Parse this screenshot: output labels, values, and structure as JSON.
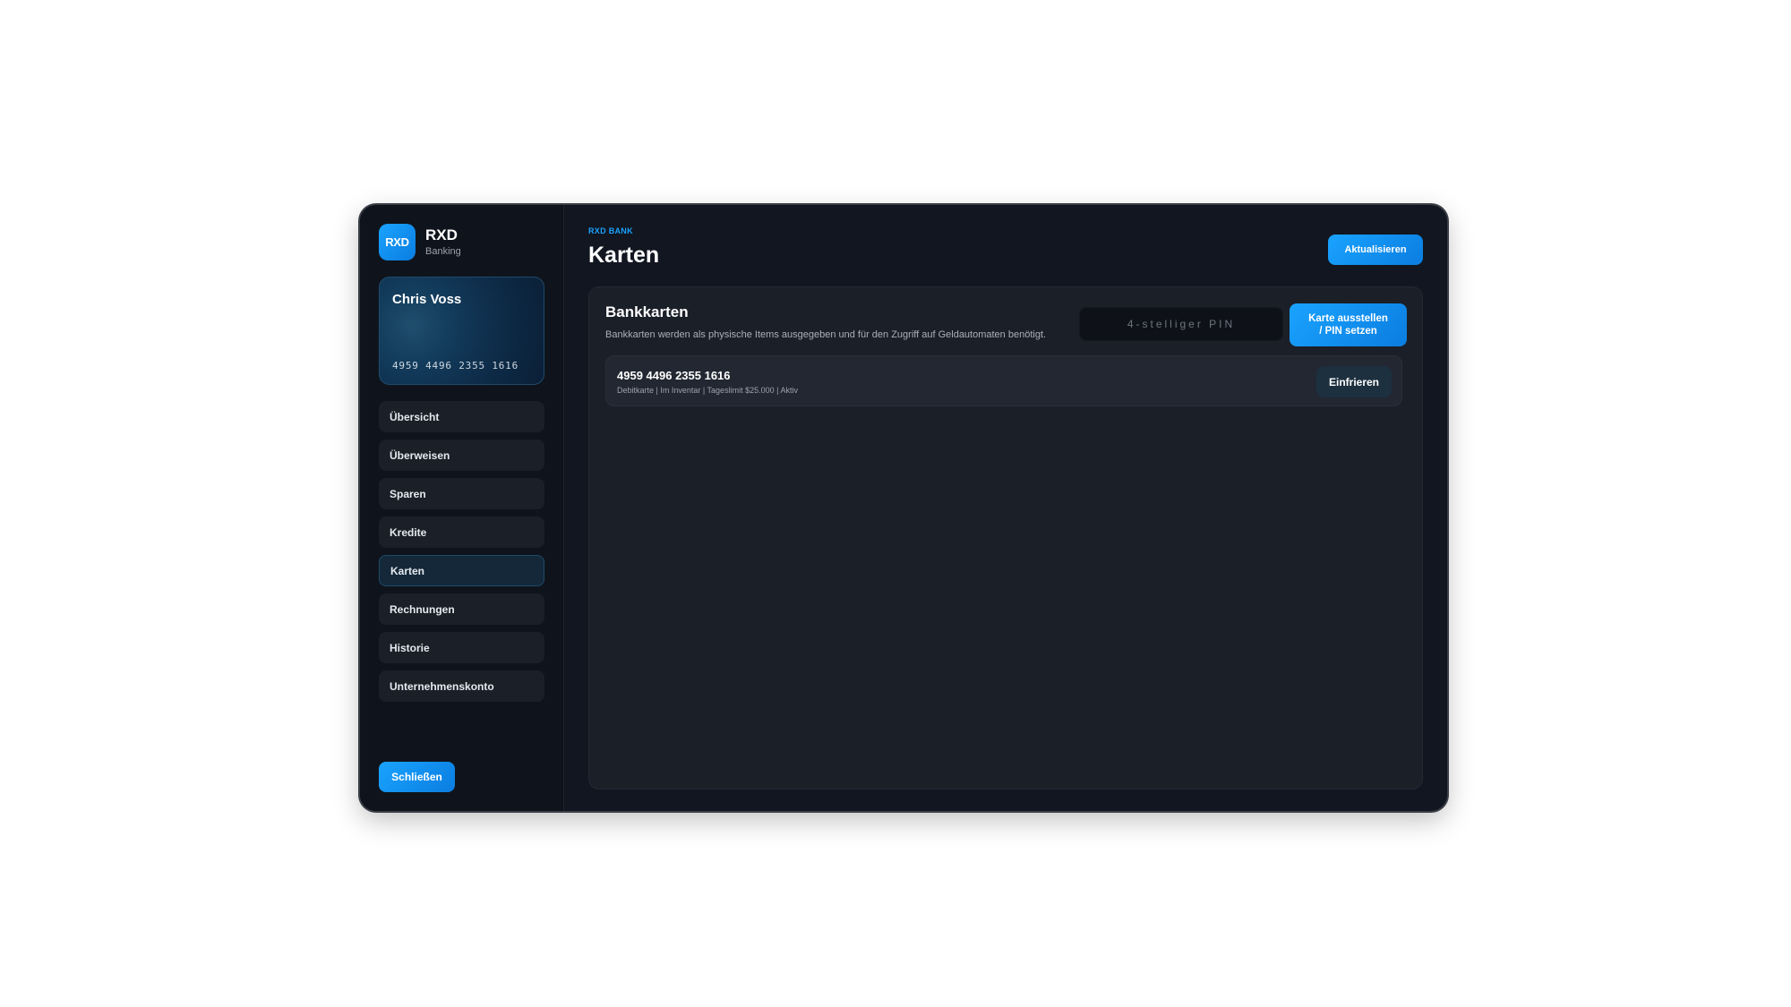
{
  "brand": {
    "logo_text": "RXD",
    "name": "RXD",
    "subtitle": "Banking"
  },
  "account_card": {
    "holder": "Chris Voss",
    "number": "4959 4496 2355 1616"
  },
  "sidebar": {
    "items": [
      {
        "label": "Übersicht",
        "active": false
      },
      {
        "label": "Überweisen",
        "active": false
      },
      {
        "label": "Sparen",
        "active": false
      },
      {
        "label": "Kredite",
        "active": false
      },
      {
        "label": "Karten",
        "active": true
      },
      {
        "label": "Rechnungen",
        "active": false
      },
      {
        "label": "Historie",
        "active": false
      },
      {
        "label": "Unternehmenskonto",
        "active": false
      }
    ],
    "close_label": "Schließen"
  },
  "header": {
    "eyebrow": "RXD BANK",
    "title": "Karten",
    "refresh_label": "Aktualisieren"
  },
  "panel": {
    "title": "Bankkarten",
    "description": "Bankkarten werden als physische Items ausgegeben und für den Zugriff auf Geldautomaten benötigt.",
    "pin_placeholder": "4-stelliger PIN",
    "pin_value": "",
    "issue_label": "Karte ausstellen\n/ PIN setzen"
  },
  "cards": [
    {
      "number": "4959 4496 2355 1616",
      "meta": "Debitkarte | Im Inventar | Tageslimit $25.000 | Aktiv",
      "action_label": "Einfrieren"
    }
  ],
  "colors": {
    "accent": "#1aa3ff",
    "background": "#111620",
    "panel": "#1a1f28"
  }
}
